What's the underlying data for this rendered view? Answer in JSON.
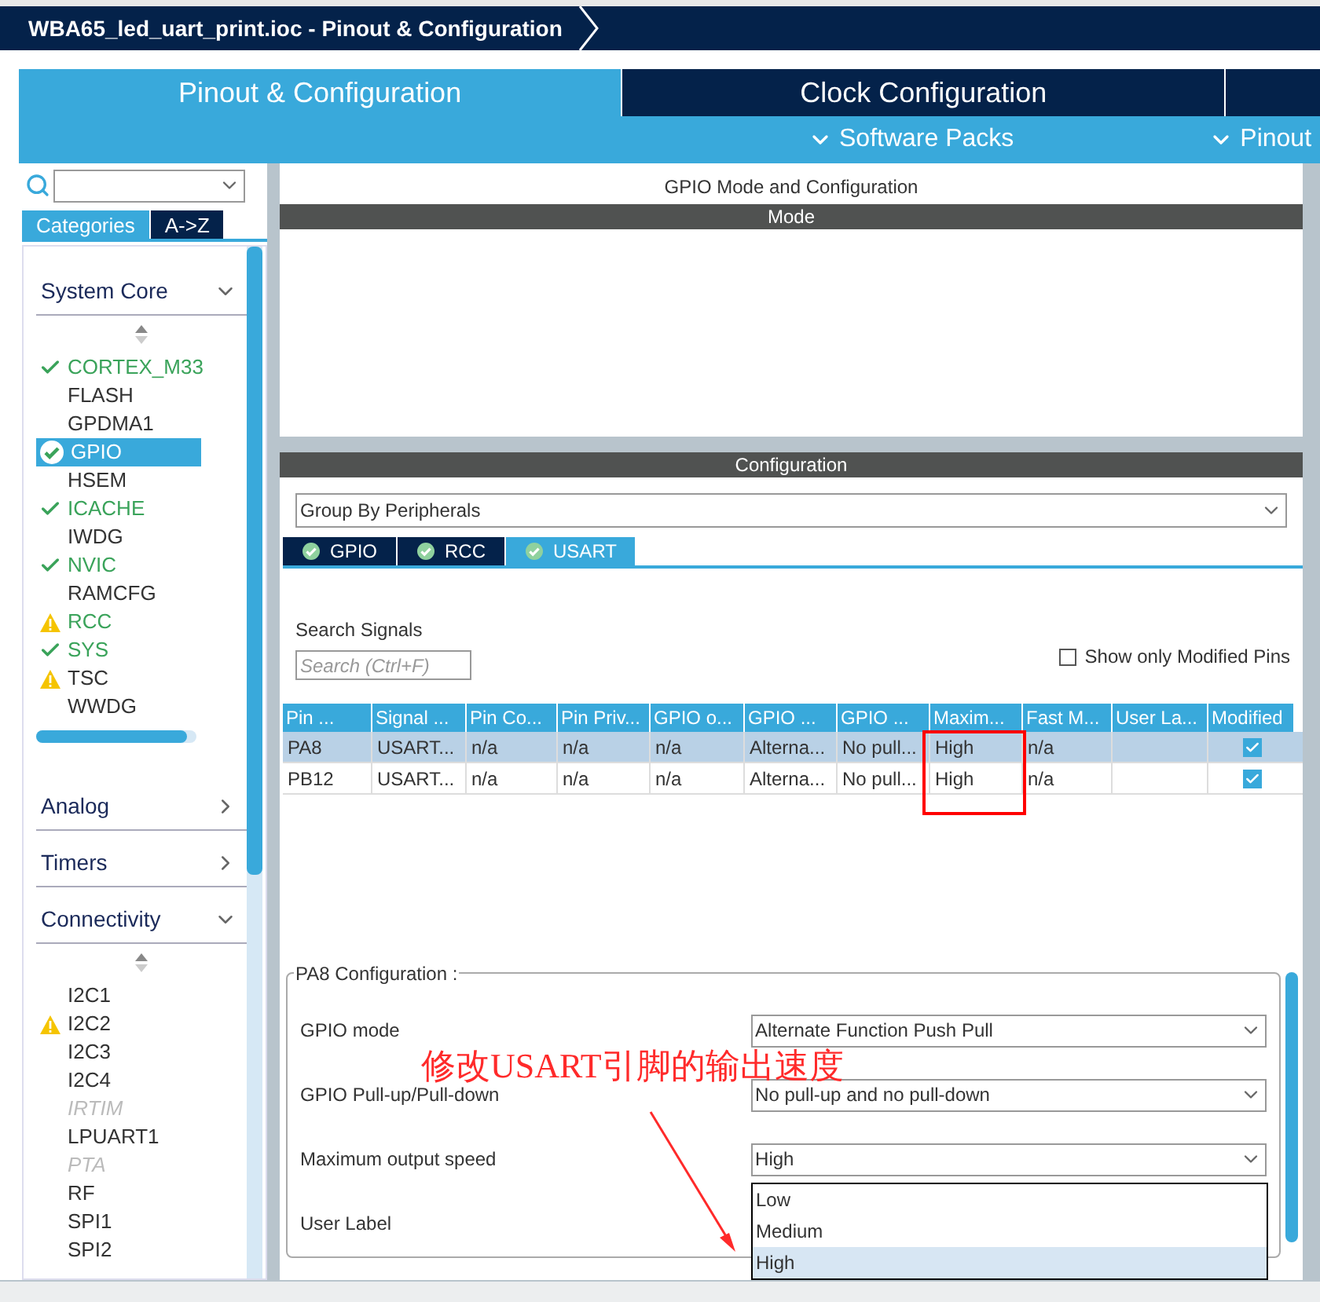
{
  "window": {
    "title": "WBA65_led_uart_print.ioc - Pinout & Configuration"
  },
  "main_tabs": [
    {
      "label": "Pinout & Configuration",
      "selected": true
    },
    {
      "label": "Clock Configuration",
      "selected": false
    }
  ],
  "menu_bar": [
    "Software Packs",
    "Pinout"
  ],
  "sidebar": {
    "view_tabs": [
      {
        "label": "Categories",
        "selected": true
      },
      {
        "label": "A->Z",
        "selected": false
      }
    ],
    "categories": [
      {
        "label": "System Core",
        "expanded": true,
        "items": [
          {
            "label": "CORTEX_M33",
            "kind": "check",
            "configured": true,
            "selected": false,
            "disabled": false
          },
          {
            "label": "FLASH",
            "kind": "plain",
            "configured": false,
            "selected": false,
            "disabled": false
          },
          {
            "label": "GPDMA1",
            "kind": "plain",
            "configured": false,
            "selected": false,
            "disabled": false
          },
          {
            "label": "GPIO",
            "kind": "check",
            "configured": true,
            "selected": true,
            "disabled": false
          },
          {
            "label": "HSEM",
            "kind": "plain",
            "configured": false,
            "selected": false,
            "disabled": false
          },
          {
            "label": "ICACHE",
            "kind": "check",
            "configured": true,
            "selected": false,
            "disabled": false
          },
          {
            "label": "IWDG",
            "kind": "plain",
            "configured": false,
            "selected": false,
            "disabled": false
          },
          {
            "label": "NVIC",
            "kind": "check",
            "configured": true,
            "selected": false,
            "disabled": false
          },
          {
            "label": "RAMCFG",
            "kind": "plain",
            "configured": false,
            "selected": false,
            "disabled": false
          },
          {
            "label": "RCC",
            "kind": "warning",
            "configured": true,
            "selected": false,
            "disabled": false
          },
          {
            "label": "SYS",
            "kind": "check",
            "configured": true,
            "selected": false,
            "disabled": false
          },
          {
            "label": "TSC",
            "kind": "warning",
            "configured": false,
            "selected": false,
            "disabled": false
          },
          {
            "label": "WWDG",
            "kind": "plain",
            "configured": false,
            "selected": false,
            "disabled": false
          }
        ]
      },
      {
        "label": "Analog",
        "expanded": false
      },
      {
        "label": "Timers",
        "expanded": false
      },
      {
        "label": "Connectivity",
        "expanded": true,
        "items": [
          {
            "label": "I2C1",
            "kind": "plain",
            "configured": false,
            "selected": false,
            "disabled": false
          },
          {
            "label": "I2C2",
            "kind": "warning",
            "configured": false,
            "selected": false,
            "disabled": false
          },
          {
            "label": "I2C3",
            "kind": "plain",
            "configured": false,
            "selected": false,
            "disabled": false
          },
          {
            "label": "I2C4",
            "kind": "plain",
            "configured": false,
            "selected": false,
            "disabled": false
          },
          {
            "label": "IRTIM",
            "kind": "plain",
            "configured": false,
            "selected": false,
            "disabled": true
          },
          {
            "label": "LPUART1",
            "kind": "plain",
            "configured": false,
            "selected": false,
            "disabled": false
          },
          {
            "label": "PTA",
            "kind": "plain",
            "configured": false,
            "selected": false,
            "disabled": true
          },
          {
            "label": "RF",
            "kind": "plain",
            "configured": false,
            "selected": false,
            "disabled": false
          },
          {
            "label": "SPI1",
            "kind": "plain",
            "configured": false,
            "selected": false,
            "disabled": false
          },
          {
            "label": "SPI2",
            "kind": "plain",
            "configured": false,
            "selected": false,
            "disabled": false
          }
        ]
      }
    ]
  },
  "panel": {
    "title": "GPIO Mode and Configuration",
    "mode_header": "Mode",
    "config_header": "Configuration",
    "group_select": "Group By Peripherals",
    "peripheral_tabs": [
      {
        "label": "GPIO",
        "selected": false
      },
      {
        "label": "RCC",
        "selected": false
      },
      {
        "label": "USART",
        "selected": true
      }
    ],
    "search_label": "Search Signals",
    "search": {
      "placeholder": "Search (Ctrl+F)"
    },
    "show_modified": {
      "label": "Show only Modified Pins",
      "checked": false
    },
    "table": {
      "columns": [
        "Pin ...",
        "Signal ...",
        "Pin Co...",
        "Pin Priv...",
        "GPIO o...",
        "GPIO ...",
        "GPIO ...",
        "Maxim...",
        "Fast M...",
        "User La...",
        "Modified"
      ],
      "rows": [
        {
          "cells": [
            "PA8",
            "USART...",
            "n/a",
            "n/a",
            "n/a",
            "Alterna...",
            "No pull...",
            "High",
            "n/a",
            ""
          ],
          "modified": true,
          "selected": true
        },
        {
          "cells": [
            "PB12",
            "USART...",
            "n/a",
            "n/a",
            "n/a",
            "Alterna...",
            "No pull...",
            "High",
            "n/a",
            ""
          ],
          "modified": true,
          "selected": false
        }
      ]
    },
    "pin_config": {
      "title": "PA8 Configuration :",
      "fields": [
        {
          "label": "GPIO mode",
          "value": "Alternate Function Push Pull"
        },
        {
          "label": "GPIO Pull-up/Pull-down",
          "value": "No pull-up and no pull-down"
        },
        {
          "label": "Maximum output speed",
          "value": "High"
        },
        {
          "label": "User Label"
        }
      ],
      "open_dropdown": [
        {
          "label": "Low",
          "selected": false
        },
        {
          "label": "Medium",
          "selected": false
        },
        {
          "label": "High",
          "selected": true
        }
      ]
    }
  },
  "annotation": {
    "text": "修改USART引脚的输出速度"
  }
}
